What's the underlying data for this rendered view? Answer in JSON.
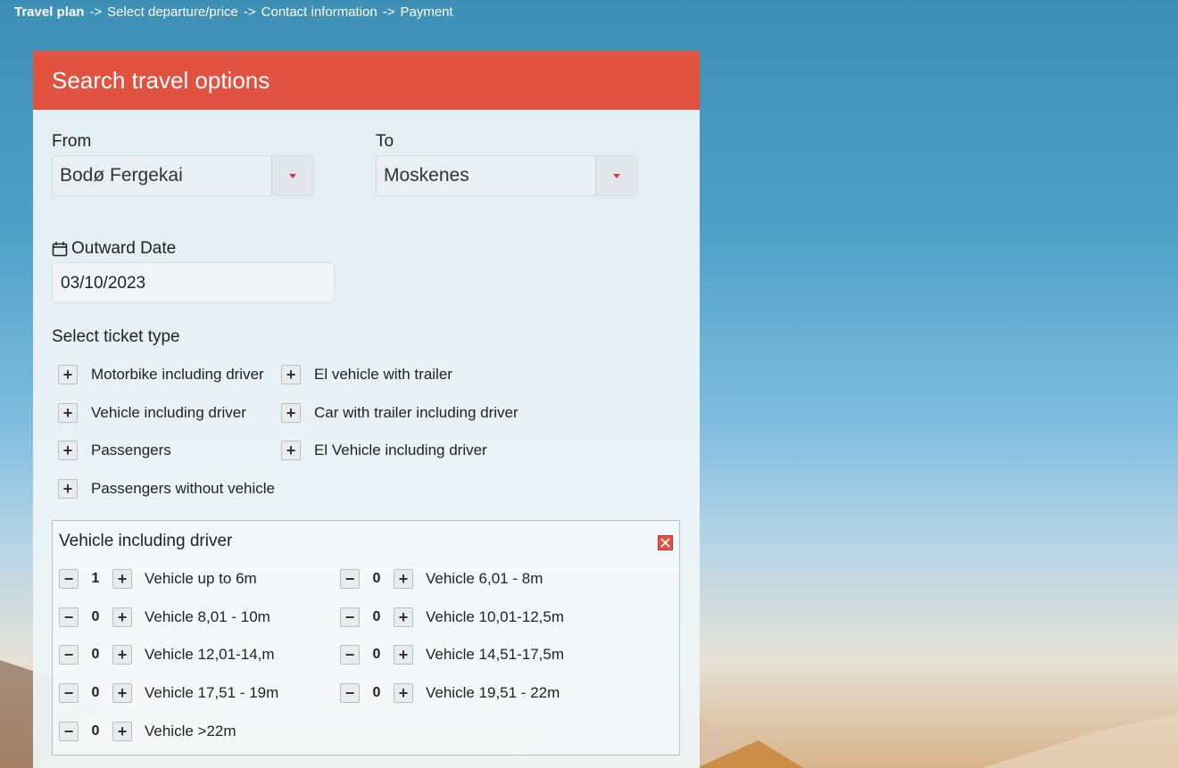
{
  "breadcrumb": {
    "steps": [
      "Travel plan",
      "Select departure/price",
      "Contact information",
      "Payment"
    ],
    "separator": "->"
  },
  "panel": {
    "title": "Search travel options",
    "from": {
      "label": "From",
      "value": "Bodø Fergekai"
    },
    "to": {
      "label": "To",
      "value": "Moskenes"
    },
    "date": {
      "label": "Outward Date",
      "value": "03/10/2023",
      "icon": "calendar-icon"
    },
    "ticket_type_label": "Select ticket type",
    "ticket_types": [
      "Motorbike including driver",
      "El vehicle with trailer",
      "Vehicle including driver",
      "Car with trailer including driver",
      "Passengers",
      "El Vehicle including driver",
      "Passengers without vehicle"
    ],
    "vehicle_box": {
      "title": "Vehicle including driver",
      "items": [
        {
          "label": "Vehicle up to 6m",
          "count": "1"
        },
        {
          "label": "Vehicle 6,01 - 8m",
          "count": "0"
        },
        {
          "label": "Vehicle 8,01 - 10m",
          "count": "0"
        },
        {
          "label": "Vehicle 10,01-12,5m",
          "count": "0"
        },
        {
          "label": "Vehicle 12,01-14,m",
          "count": "0"
        },
        {
          "label": "Vehicle 14,51-17,5m",
          "count": "0"
        },
        {
          "label": "Vehicle 17,51 - 19m",
          "count": "0"
        },
        {
          "label": "Vehicle 19,51 - 22m",
          "count": "0"
        },
        {
          "label": "Vehicle >22m",
          "count": "0"
        }
      ]
    }
  },
  "buttons": {
    "plus": "+",
    "minus": "−"
  },
  "colors": {
    "header": "#e15241",
    "caret": "#dd3333"
  }
}
